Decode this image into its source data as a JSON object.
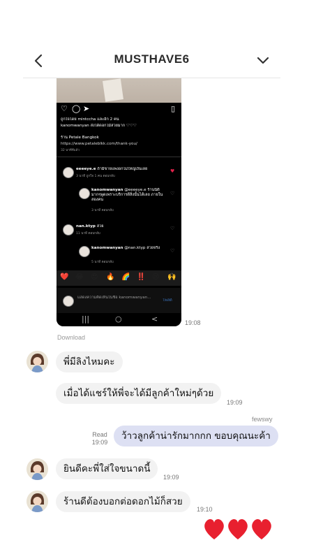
{
  "header": {
    "title": "MUSTHAVE6",
    "back_icon": "chevron-left-icon",
    "menu_icon": "chevron-down-icon"
  },
  "shared_image": {
    "likes_line": "ถูกใจโดย mintccha และอีก 2 คน",
    "caption": "kanomwanyan ส่งได้ดอกไม้สวยมาก ♡♡♡",
    "shop_name": "ร้าน Petale Bangkok",
    "shop_url": "https://www.petaleblkk.com/thank-you/",
    "post_time": "32 นาทีที่แล้ว",
    "comments": [
      {
        "user": "eeeeye.e",
        "text": "ถ้ามีขายแพงอกไม่ใหญ่เงินเลย",
        "meta": "3 นาที   ถูกใจ 1 คน   ตอบกลับ",
        "liked": true
      },
      {
        "user": "kanomwanyan",
        "text": "@eeeeye.e ร้านนี้ดีมากๆพูดเพราะบริการดีสิ่งนั้นได้เลย ภายในสองคน",
        "meta": "3 นาที   ตอบกลับ",
        "liked": false
      },
      {
        "user": "nan.ktyp",
        "text": "สวย",
        "meta": "11 นาที   ตอบกลับ",
        "liked": false
      },
      {
        "user": "kanomwanyan",
        "text": "@nan.ktyp สวยจริง",
        "meta": "5 นาที   ตอบกลับ",
        "liked": false
      }
    ],
    "emojis": [
      "❤️",
      "😂",
      "😍",
      "🔥",
      "🌈",
      "‼️",
      "😢",
      "🙌"
    ],
    "comment_placeholder": "แสดงความคิดเห็นในชื่อ kanomwanyan...",
    "post_label": "โพสต์",
    "nav": [
      "|||",
      "○",
      "<"
    ]
  },
  "messages": {
    "image_time": "19:08",
    "download_label": "Download",
    "m1_text": "พี่มีลิงไหมคะ",
    "m2_text": "เมื่อได้แชร์ให้พี่จะได้มีลูกค้าใหม่ๆด้วย",
    "m2_time": "19:09",
    "my_sender": "fewswy",
    "my_read": "Read",
    "my_time": "19:09",
    "my_text": "ว้าวลูกค้าน่ารักมากกก ขอบคุณนะค้า",
    "m3_text": "ยินดีคะพี่ใส่ใจขนาดนี้",
    "m3_time": "19:09",
    "m4_text": "ร้านดีต้องบอกต่อดอกไม้ก็สวย",
    "m4_time": "19:10"
  },
  "reaction": "❤️❤️❤️"
}
